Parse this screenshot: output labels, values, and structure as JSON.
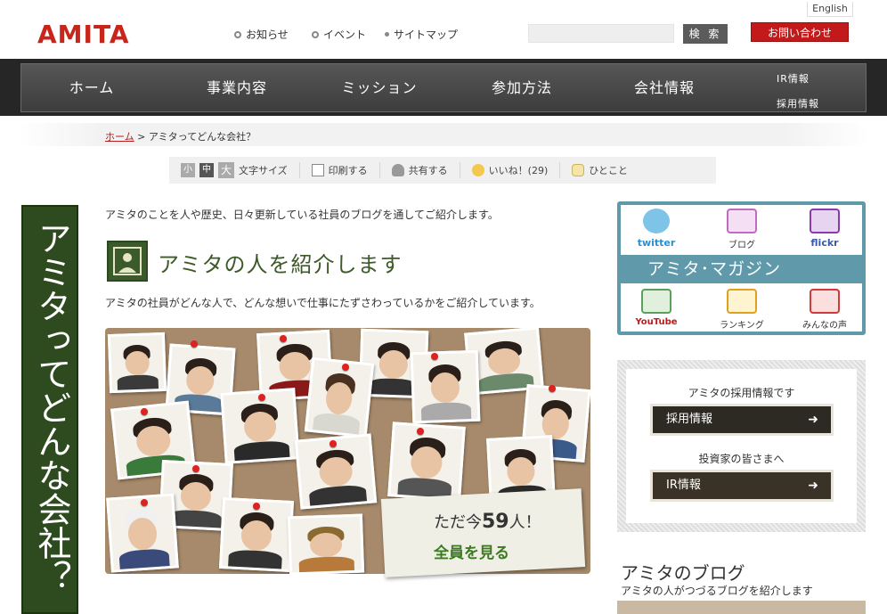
{
  "header": {
    "logo": "AMITA",
    "english": "English",
    "links": [
      "お知らせ",
      "イベント",
      "サイトマップ"
    ],
    "search_placeholder": "",
    "search_button": "検 索",
    "contact_button": "お問い合わせ"
  },
  "nav": {
    "items": [
      "ホーム",
      "事業内容",
      "ミッション",
      "参加方法",
      "会社情報"
    ],
    "sub_items": [
      "IR情報",
      "採用情報"
    ]
  },
  "breadcrumb": {
    "home": "ホーム",
    "separator": " > ",
    "current": "アミタってどんな会社？"
  },
  "toolbar": {
    "size_small": "小",
    "size_medium": "中",
    "size_large": "大",
    "font_size": "文字サイズ",
    "print": "印刷する",
    "share": "共有する",
    "like": "いいね！(29)",
    "comment": "ひとこと"
  },
  "banner": {
    "vertical_title": "アミタってどんな会社？"
  },
  "main": {
    "intro": "アミタのことを人や歴史、日々更新している社員のブログを通してご紹介します。",
    "section_title": "アミタの人を紹介します",
    "section_desc": "アミタの社員がどんな人で、どんな想いで仕事にたずさわっているかをご紹介しています。",
    "count_prefix": "ただ今",
    "count_value": "59",
    "count_suffix": "人！",
    "all_button": "全員を見る"
  },
  "sidebar": {
    "magazine_items_top": [
      "twitter",
      "ブログ",
      "flickr"
    ],
    "magazine_title": "アミタ･マガジン",
    "magazine_items_bottom": [
      "YouTube",
      "ランキング",
      "みんなの声"
    ],
    "recruit_label": "アミタの採用情報です",
    "recruit_button": "採用情報",
    "investor_label": "投資家の皆さまへ",
    "ir_button": "IR情報",
    "blog_title": "アミタのブログ",
    "blog_sub": "アミタの人がつづるブログを紹介します"
  },
  "colors": {
    "brand_red": "#c8251b",
    "nav_dark": "#262626",
    "green": "#3d5a2a",
    "magazine_blue": "#5f99aa"
  }
}
